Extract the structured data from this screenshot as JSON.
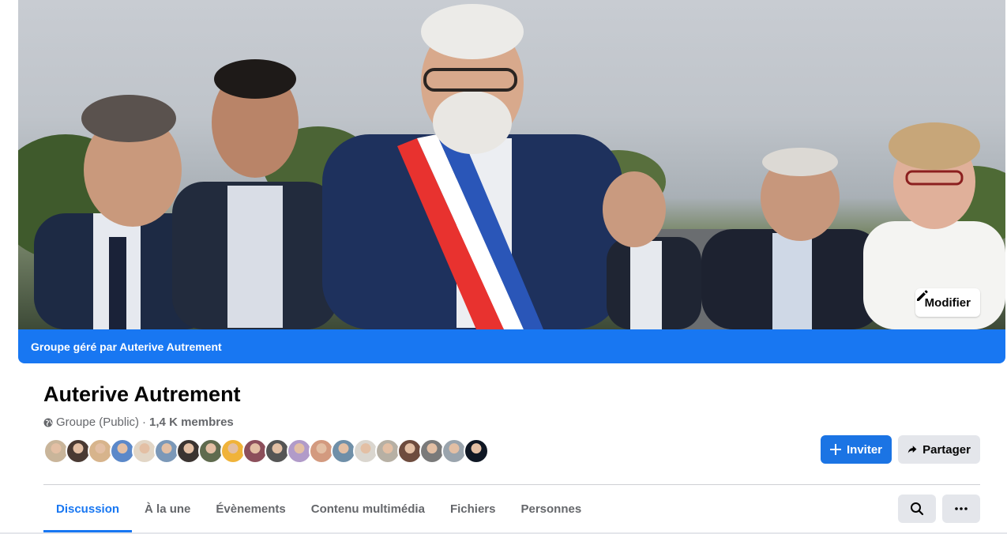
{
  "cover": {
    "edit_label": "Modifier",
    "banner_text": "Groupe géré par Auterive Autrement"
  },
  "group": {
    "name": "Auterive Autrement",
    "privacy": "Groupe (Public)",
    "separator": "·",
    "members": "1,4 K membres"
  },
  "members_preview": {
    "avatar_colors": [
      "#c9b59a",
      "#4a3a33",
      "#d7b48c",
      "#5b88c9",
      "#e2d6c6",
      "#7b98b8",
      "#3b3431",
      "#5f6b4e",
      "#f0b33a",
      "#8c4f5b",
      "#555555",
      "#b19bc9",
      "#d39a7f",
      "#6f8fa8",
      "#dad6cf",
      "#b7b0a4",
      "#6e4c3e",
      "#7a7a7a",
      "#9aa4ad",
      "#0f1724"
    ]
  },
  "actions": {
    "invite_label": "Inviter",
    "share_label": "Partager"
  },
  "tabs": [
    {
      "label": "Discussion",
      "active": true
    },
    {
      "label": "À la une"
    },
    {
      "label": "Évènements"
    },
    {
      "label": "Contenu multimédia"
    },
    {
      "label": "Fichiers"
    },
    {
      "label": "Personnes"
    }
  ],
  "colors": {
    "accent": "#1877f2",
    "button_secondary": "#e4e6eb"
  }
}
